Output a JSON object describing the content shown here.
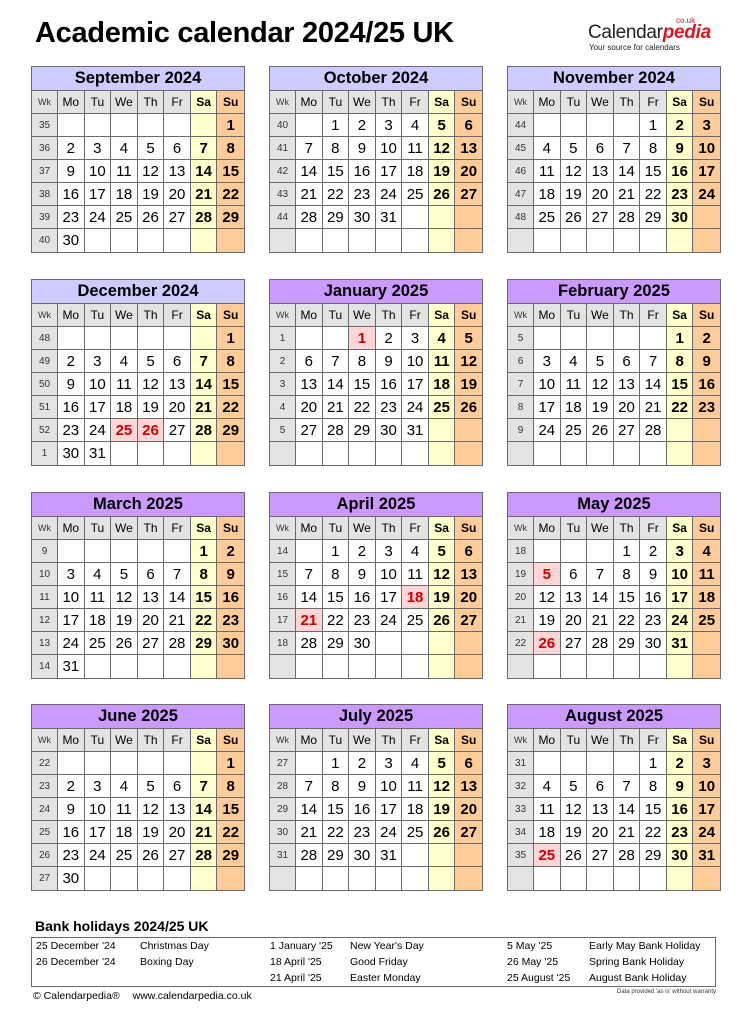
{
  "title": "Academic calendar 2024/25 UK",
  "logo": {
    "brand_main": "Calendar",
    "brand_accent": "pedia",
    "domain_suffix": "co.uk",
    "tagline": "Your source for calendars"
  },
  "colors": {
    "header_2024": "#ccccff",
    "header_2025": "#cc99ff",
    "saturday": "#ffffcc",
    "sunday": "#ffcc99",
    "weekday_header": "#e3e3e3",
    "holiday_bg": "#ffd5d5",
    "holiday_text": "#d10000"
  },
  "weekday_headers": [
    "Wk",
    "Mo",
    "Tu",
    "We",
    "Th",
    "Fr",
    "Sa",
    "Su"
  ],
  "months": [
    {
      "name": "September 2024",
      "year": 2024,
      "weeks": [
        {
          "wk": "35",
          "days": [
            "",
            "",
            "",
            "",
            "",
            "",
            "1"
          ]
        },
        {
          "wk": "36",
          "days": [
            "2",
            "3",
            "4",
            "5",
            "6",
            "7",
            "8"
          ]
        },
        {
          "wk": "37",
          "days": [
            "9",
            "10",
            "11",
            "12",
            "13",
            "14",
            "15"
          ]
        },
        {
          "wk": "38",
          "days": [
            "16",
            "17",
            "18",
            "19",
            "20",
            "21",
            "22"
          ]
        },
        {
          "wk": "39",
          "days": [
            "23",
            "24",
            "25",
            "26",
            "27",
            "28",
            "29"
          ]
        },
        {
          "wk": "40",
          "days": [
            "30",
            "",
            "",
            "",
            "",
            "",
            ""
          ]
        }
      ],
      "holidays": []
    },
    {
      "name": "October 2024",
      "year": 2024,
      "weeks": [
        {
          "wk": "40",
          "days": [
            "",
            "1",
            "2",
            "3",
            "4",
            "5",
            "6"
          ]
        },
        {
          "wk": "41",
          "days": [
            "7",
            "8",
            "9",
            "10",
            "11",
            "12",
            "13"
          ]
        },
        {
          "wk": "42",
          "days": [
            "14",
            "15",
            "16",
            "17",
            "18",
            "19",
            "20"
          ]
        },
        {
          "wk": "43",
          "days": [
            "21",
            "22",
            "23",
            "24",
            "25",
            "26",
            "27"
          ]
        },
        {
          "wk": "44",
          "days": [
            "28",
            "29",
            "30",
            "31",
            "",
            "",
            ""
          ]
        },
        {
          "wk": "",
          "days": [
            "",
            "",
            "",
            "",
            "",
            "",
            ""
          ]
        }
      ],
      "holidays": []
    },
    {
      "name": "November 2024",
      "year": 2024,
      "weeks": [
        {
          "wk": "44",
          "days": [
            "",
            "",
            "",
            "",
            "1",
            "2",
            "3"
          ]
        },
        {
          "wk": "45",
          "days": [
            "4",
            "5",
            "6",
            "7",
            "8",
            "9",
            "10"
          ]
        },
        {
          "wk": "46",
          "days": [
            "11",
            "12",
            "13",
            "14",
            "15",
            "16",
            "17"
          ]
        },
        {
          "wk": "47",
          "days": [
            "18",
            "19",
            "20",
            "21",
            "22",
            "23",
            "24"
          ]
        },
        {
          "wk": "48",
          "days": [
            "25",
            "26",
            "27",
            "28",
            "29",
            "30",
            ""
          ]
        },
        {
          "wk": "",
          "days": [
            "",
            "",
            "",
            "",
            "",
            "",
            ""
          ]
        }
      ],
      "holidays": []
    },
    {
      "name": "December 2024",
      "year": 2024,
      "weeks": [
        {
          "wk": "48",
          "days": [
            "",
            "",
            "",
            "",
            "",
            "",
            "1"
          ]
        },
        {
          "wk": "49",
          "days": [
            "2",
            "3",
            "4",
            "5",
            "6",
            "7",
            "8"
          ]
        },
        {
          "wk": "50",
          "days": [
            "9",
            "10",
            "11",
            "12",
            "13",
            "14",
            "15"
          ]
        },
        {
          "wk": "51",
          "days": [
            "16",
            "17",
            "18",
            "19",
            "20",
            "21",
            "22"
          ]
        },
        {
          "wk": "52",
          "days": [
            "23",
            "24",
            "25",
            "26",
            "27",
            "28",
            "29"
          ]
        },
        {
          "wk": "1",
          "days": [
            "30",
            "31",
            "",
            "",
            "",
            "",
            ""
          ]
        }
      ],
      "holidays": [
        "25",
        "26"
      ]
    },
    {
      "name": "January 2025",
      "year": 2025,
      "weeks": [
        {
          "wk": "1",
          "days": [
            "",
            "",
            "1",
            "2",
            "3",
            "4",
            "5"
          ]
        },
        {
          "wk": "2",
          "days": [
            "6",
            "7",
            "8",
            "9",
            "10",
            "11",
            "12"
          ]
        },
        {
          "wk": "3",
          "days": [
            "13",
            "14",
            "15",
            "16",
            "17",
            "18",
            "19"
          ]
        },
        {
          "wk": "4",
          "days": [
            "20",
            "21",
            "22",
            "23",
            "24",
            "25",
            "26"
          ]
        },
        {
          "wk": "5",
          "days": [
            "27",
            "28",
            "29",
            "30",
            "31",
            "",
            ""
          ]
        },
        {
          "wk": "",
          "days": [
            "",
            "",
            "",
            "",
            "",
            "",
            ""
          ]
        }
      ],
      "holidays": [
        "1"
      ]
    },
    {
      "name": "February 2025",
      "year": 2025,
      "weeks": [
        {
          "wk": "5",
          "days": [
            "",
            "",
            "",
            "",
            "",
            "1",
            "2"
          ]
        },
        {
          "wk": "6",
          "days": [
            "3",
            "4",
            "5",
            "6",
            "7",
            "8",
            "9"
          ]
        },
        {
          "wk": "7",
          "days": [
            "10",
            "11",
            "12",
            "13",
            "14",
            "15",
            "16"
          ]
        },
        {
          "wk": "8",
          "days": [
            "17",
            "18",
            "19",
            "20",
            "21",
            "22",
            "23"
          ]
        },
        {
          "wk": "9",
          "days": [
            "24",
            "25",
            "26",
            "27",
            "28",
            "",
            ""
          ]
        },
        {
          "wk": "",
          "days": [
            "",
            "",
            "",
            "",
            "",
            "",
            ""
          ]
        }
      ],
      "holidays": []
    },
    {
      "name": "March 2025",
      "year": 2025,
      "weeks": [
        {
          "wk": "9",
          "days": [
            "",
            "",
            "",
            "",
            "",
            "1",
            "2"
          ]
        },
        {
          "wk": "10",
          "days": [
            "3",
            "4",
            "5",
            "6",
            "7",
            "8",
            "9"
          ]
        },
        {
          "wk": "11",
          "days": [
            "10",
            "11",
            "12",
            "13",
            "14",
            "15",
            "16"
          ]
        },
        {
          "wk": "12",
          "days": [
            "17",
            "18",
            "19",
            "20",
            "21",
            "22",
            "23"
          ]
        },
        {
          "wk": "13",
          "days": [
            "24",
            "25",
            "26",
            "27",
            "28",
            "29",
            "30"
          ]
        },
        {
          "wk": "14",
          "days": [
            "31",
            "",
            "",
            "",
            "",
            "",
            ""
          ]
        }
      ],
      "holidays": []
    },
    {
      "name": "April 2025",
      "year": 2025,
      "weeks": [
        {
          "wk": "14",
          "days": [
            "",
            "1",
            "2",
            "3",
            "4",
            "5",
            "6"
          ]
        },
        {
          "wk": "15",
          "days": [
            "7",
            "8",
            "9",
            "10",
            "11",
            "12",
            "13"
          ]
        },
        {
          "wk": "16",
          "days": [
            "14",
            "15",
            "16",
            "17",
            "18",
            "19",
            "20"
          ]
        },
        {
          "wk": "17",
          "days": [
            "21",
            "22",
            "23",
            "24",
            "25",
            "26",
            "27"
          ]
        },
        {
          "wk": "18",
          "days": [
            "28",
            "29",
            "30",
            "",
            "",
            "",
            ""
          ]
        },
        {
          "wk": "",
          "days": [
            "",
            "",
            "",
            "",
            "",
            "",
            ""
          ]
        }
      ],
      "holidays": [
        "18",
        "21"
      ]
    },
    {
      "name": "May 2025",
      "year": 2025,
      "weeks": [
        {
          "wk": "18",
          "days": [
            "",
            "",
            "",
            "1",
            "2",
            "3",
            "4"
          ]
        },
        {
          "wk": "19",
          "days": [
            "5",
            "6",
            "7",
            "8",
            "9",
            "10",
            "11"
          ]
        },
        {
          "wk": "20",
          "days": [
            "12",
            "13",
            "14",
            "15",
            "16",
            "17",
            "18"
          ]
        },
        {
          "wk": "21",
          "days": [
            "19",
            "20",
            "21",
            "22",
            "23",
            "24",
            "25"
          ]
        },
        {
          "wk": "22",
          "days": [
            "26",
            "27",
            "28",
            "29",
            "30",
            "31",
            ""
          ]
        },
        {
          "wk": "",
          "days": [
            "",
            "",
            "",
            "",
            "",
            "",
            ""
          ]
        }
      ],
      "holidays": [
        "5",
        "26"
      ]
    },
    {
      "name": "June 2025",
      "year": 2025,
      "weeks": [
        {
          "wk": "22",
          "days": [
            "",
            "",
            "",
            "",
            "",
            "",
            "1"
          ]
        },
        {
          "wk": "23",
          "days": [
            "2",
            "3",
            "4",
            "5",
            "6",
            "7",
            "8"
          ]
        },
        {
          "wk": "24",
          "days": [
            "9",
            "10",
            "11",
            "12",
            "13",
            "14",
            "15"
          ]
        },
        {
          "wk": "25",
          "days": [
            "16",
            "17",
            "18",
            "19",
            "20",
            "21",
            "22"
          ]
        },
        {
          "wk": "26",
          "days": [
            "23",
            "24",
            "25",
            "26",
            "27",
            "28",
            "29"
          ]
        },
        {
          "wk": "27",
          "days": [
            "30",
            "",
            "",
            "",
            "",
            "",
            ""
          ]
        }
      ],
      "holidays": []
    },
    {
      "name": "July 2025",
      "year": 2025,
      "weeks": [
        {
          "wk": "27",
          "days": [
            "",
            "1",
            "2",
            "3",
            "4",
            "5",
            "6"
          ]
        },
        {
          "wk": "28",
          "days": [
            "7",
            "8",
            "9",
            "10",
            "11",
            "12",
            "13"
          ]
        },
        {
          "wk": "29",
          "days": [
            "14",
            "15",
            "16",
            "17",
            "18",
            "19",
            "20"
          ]
        },
        {
          "wk": "30",
          "days": [
            "21",
            "22",
            "23",
            "24",
            "25",
            "26",
            "27"
          ]
        },
        {
          "wk": "31",
          "days": [
            "28",
            "29",
            "30",
            "31",
            "",
            "",
            ""
          ]
        },
        {
          "wk": "",
          "days": [
            "",
            "",
            "",
            "",
            "",
            "",
            ""
          ]
        }
      ],
      "holidays": []
    },
    {
      "name": "August 2025",
      "year": 2025,
      "weeks": [
        {
          "wk": "31",
          "days": [
            "",
            "",
            "",
            "",
            "1",
            "2",
            "3"
          ]
        },
        {
          "wk": "32",
          "days": [
            "4",
            "5",
            "6",
            "7",
            "8",
            "9",
            "10"
          ]
        },
        {
          "wk": "33",
          "days": [
            "11",
            "12",
            "13",
            "14",
            "15",
            "16",
            "17"
          ]
        },
        {
          "wk": "34",
          "days": [
            "18",
            "19",
            "20",
            "21",
            "22",
            "23",
            "24"
          ]
        },
        {
          "wk": "35",
          "days": [
            "25",
            "26",
            "27",
            "28",
            "29",
            "30",
            "31"
          ]
        },
        {
          "wk": "",
          "days": [
            "",
            "",
            "",
            "",
            "",
            "",
            ""
          ]
        }
      ],
      "holidays": [
        "25"
      ]
    }
  ],
  "bank_holidays": {
    "title": "Bank holidays 2024/25 UK",
    "columns": [
      [
        {
          "date": "25 December '24",
          "name": "Christmas Day"
        },
        {
          "date": "26 December '24",
          "name": "Boxing Day"
        }
      ],
      [
        {
          "date": "1 January '25",
          "name": "New Year's Day"
        },
        {
          "date": "18 April '25",
          "name": "Good Friday"
        },
        {
          "date": "21 April '25",
          "name": "Easter Monday"
        }
      ],
      [
        {
          "date": "5 May '25",
          "name": "Early May Bank Holiday"
        },
        {
          "date": "26 May '25",
          "name": "Spring Bank Holiday"
        },
        {
          "date": "25 August '25",
          "name": "August Bank Holiday"
        }
      ]
    ]
  },
  "footer": {
    "copyright": "© Calendarpedia®",
    "url": "www.calendarpedia.co.uk",
    "disclaimer": "Data provided 'as is' without warranty"
  }
}
